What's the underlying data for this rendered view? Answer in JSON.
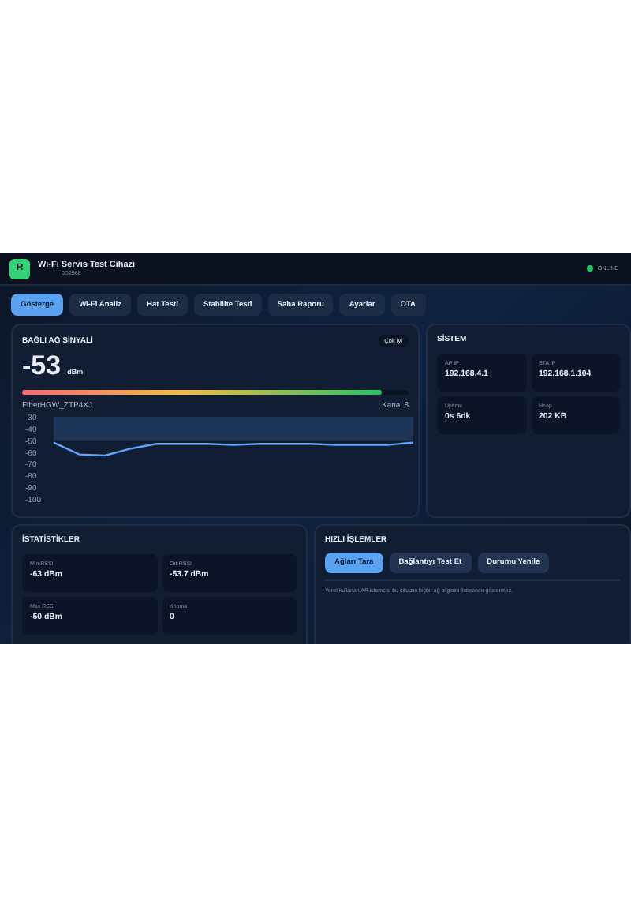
{
  "header": {
    "logo": "R",
    "title": "Wi-Fi Servis Test Cihazı",
    "subtitle": "0D2568",
    "status": {
      "label": "ONLINE",
      "color": "#22c55e"
    }
  },
  "tabs": [
    {
      "label": "Gösterge",
      "selected": true
    },
    {
      "label": "Wi-Fi Analiz",
      "selected": false
    },
    {
      "label": "Hat Testi",
      "selected": false
    },
    {
      "label": "Stabilite Testi",
      "selected": false
    },
    {
      "label": "Saha Raporu",
      "selected": false
    },
    {
      "label": "Ayarlar",
      "selected": false
    },
    {
      "label": "OTA",
      "selected": false
    }
  ],
  "signal": {
    "title": "BAĞLI AĞ SİNYALİ",
    "badge": "Çok iyi",
    "value": "-53",
    "unit": "dBm",
    "level": 0.93,
    "ssid": "FiberHGW_ZTP4XJ",
    "channel": "Kanal 8",
    "chart_data": {
      "type": "line",
      "ylim": [
        -100,
        -30
      ],
      "yticks": [
        -30,
        -40,
        -50,
        -60,
        -70,
        -80,
        -90,
        -100
      ],
      "series": [
        {
          "color": "#60a5fa",
          "values": [
            -52,
            -62,
            -63,
            -57,
            -53,
            -53,
            -53,
            -54,
            -53,
            -53,
            -53,
            -54,
            -54,
            -54,
            -52
          ]
        }
      ]
    }
  },
  "system": {
    "title": "SİSTEM",
    "items": [
      {
        "label": "AP IP",
        "value": "192.168.4.1"
      },
      {
        "label": "STA IP",
        "value": "192.168.1.104"
      },
      {
        "label": "Uptime",
        "value": "0s 6dk"
      },
      {
        "label": "Heap",
        "value": "202 KB"
      }
    ]
  },
  "stats": {
    "title": "İSTATİSTİKLER",
    "items": [
      {
        "label": "Min RSSI",
        "value": "-63 dBm"
      },
      {
        "label": "Ort RSSI",
        "value": "-53.7 dBm"
      },
      {
        "label": "Max RSSI",
        "value": "-50 dBm"
      },
      {
        "label": "Kopma",
        "value": "0"
      }
    ]
  },
  "actions": {
    "title": "HIZLI İŞLEMLER",
    "buttons": [
      {
        "label": "Ağları Tara",
        "selected": true
      },
      {
        "label": "Bağlantıyı Test Et",
        "selected": false
      },
      {
        "label": "Durumu Yenile",
        "selected": false
      }
    ],
    "note": "Yerel kullanan AP istemcisi bu cihazın hiçbir ağ bilgisini listesinde göstermez."
  }
}
